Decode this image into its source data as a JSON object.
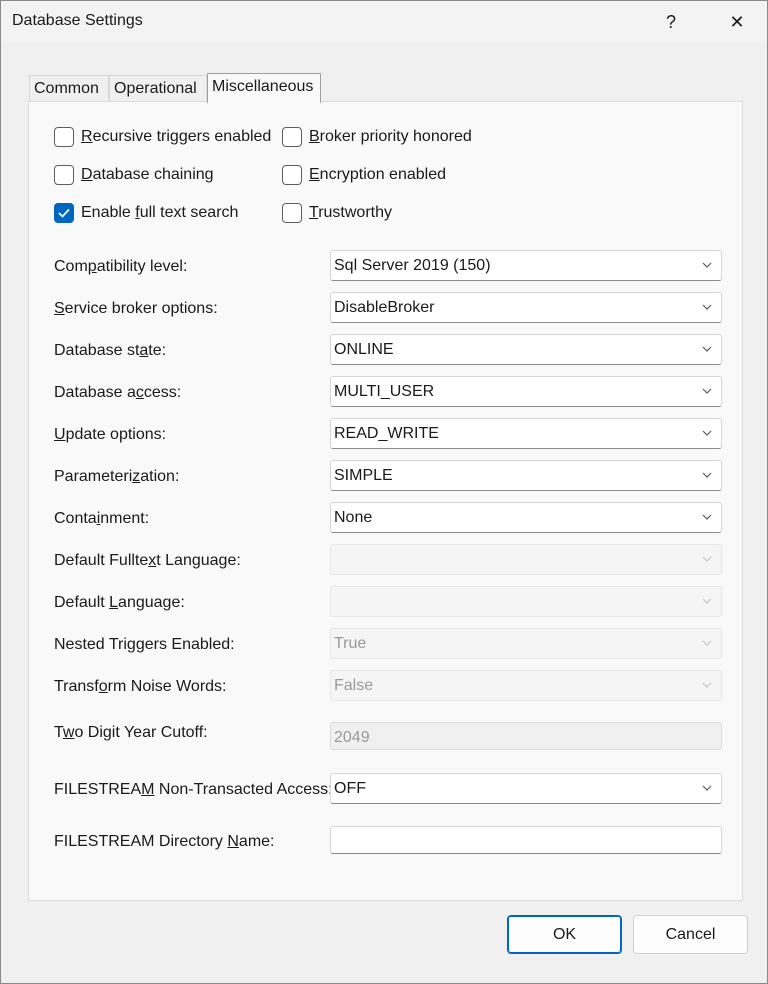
{
  "window": {
    "title": "Database Settings",
    "help_label": "?",
    "close_label": "✕"
  },
  "tabs": [
    {
      "label": "Common",
      "selected": false
    },
    {
      "label": "Operational",
      "selected": false
    },
    {
      "label": "Miscellaneous",
      "selected": true
    }
  ],
  "checkboxes": {
    "recursive_triggers": {
      "pre": "",
      "key": "R",
      "post": "ecursive triggers enabled",
      "checked": false
    },
    "broker_priority": {
      "pre": "",
      "key": "B",
      "post": "roker priority honored",
      "checked": false
    },
    "database_chaining": {
      "pre": "",
      "key": "D",
      "post": "atabase chaining",
      "checked": false
    },
    "encryption": {
      "pre": "",
      "key": "E",
      "post": "ncryption enabled",
      "checked": false
    },
    "full_text_search": {
      "pre": "Enable ",
      "key": "f",
      "post": "ull text search",
      "checked": true
    },
    "trustworthy": {
      "pre": "",
      "key": "T",
      "post": "rustworthy",
      "checked": false
    }
  },
  "fields": {
    "compatibility": {
      "pre": "Com",
      "key": "p",
      "post": "atibility level:",
      "value": "Sql Server 2019 (150)"
    },
    "service_broker": {
      "pre": "",
      "key": "S",
      "post": "ervice broker options:",
      "value": "DisableBroker"
    },
    "db_state": {
      "pre": "Database st",
      "key": "a",
      "post": "te:",
      "value": "ONLINE"
    },
    "db_access": {
      "pre": "Database a",
      "key": "c",
      "post": "cess:",
      "value": "MULTI_USER"
    },
    "update_options": {
      "pre": "",
      "key": "U",
      "post": "pdate options:",
      "value": "READ_WRITE"
    },
    "parameterization": {
      "pre": "Parameteri",
      "key": "z",
      "post": "ation:",
      "value": "SIMPLE"
    },
    "containment": {
      "pre": "Conta",
      "key": "i",
      "post": "nment:",
      "value": "None"
    },
    "fulltext_language": {
      "pre": "Default Fullte",
      "key": "x",
      "post": "t Language:",
      "value": ""
    },
    "default_language": {
      "pre": "Default ",
      "key": "L",
      "post": "anguage:",
      "value": ""
    },
    "nested_triggers": {
      "pre": "Nested Tri",
      "key": "g",
      "post": "gers Enabled:",
      "value": "True"
    },
    "noise_words": {
      "pre": "Transf",
      "key": "o",
      "post": "rm Noise Words:",
      "value": "False"
    },
    "year_cutoff": {
      "pre": "T",
      "key": "w",
      "post": "o Digit Year Cutoff:",
      "value": "2049"
    },
    "filestream_access": {
      "pre": "FILESTREA",
      "key": "M",
      "post": " Non-Transacted Access:",
      "value": "OFF"
    },
    "filestream_dir": {
      "pre": "FILESTREAM Directory ",
      "key": "N",
      "post": "ame:",
      "value": ""
    }
  },
  "buttons": {
    "ok": "OK",
    "cancel": "Cancel"
  },
  "colors": {
    "accent": "#0067c0"
  }
}
